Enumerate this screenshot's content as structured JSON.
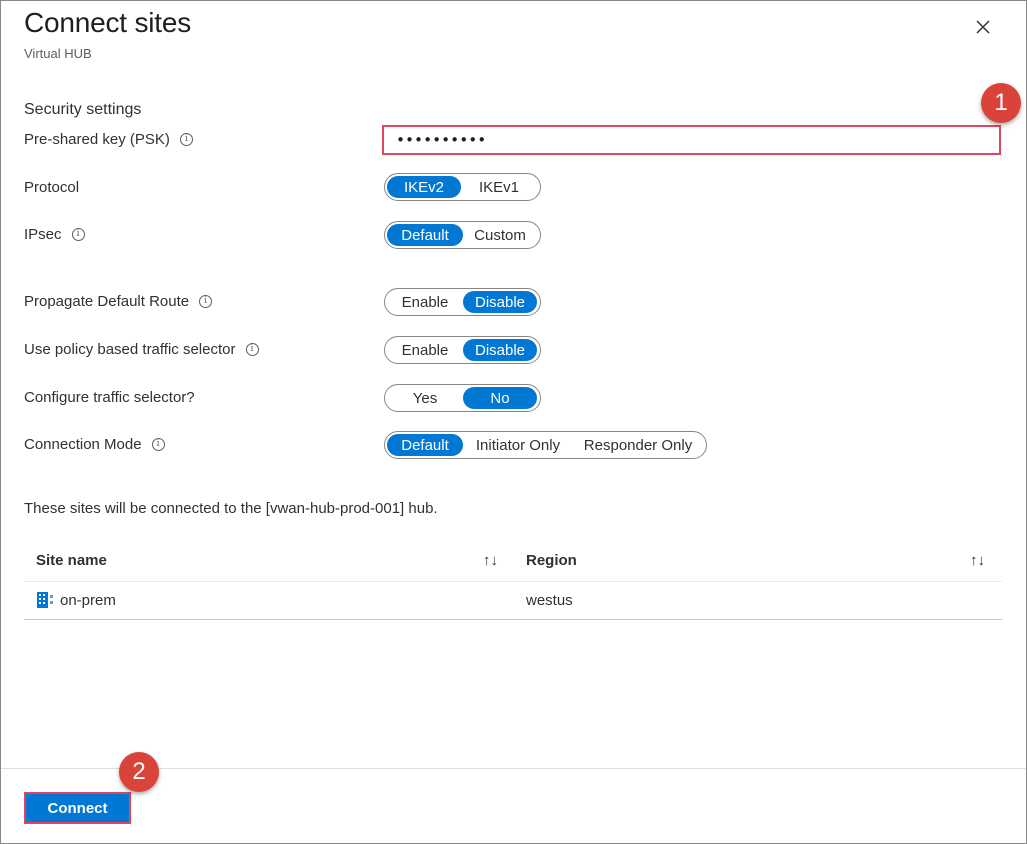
{
  "header": {
    "title": "Connect sites",
    "subtitle": "Virtual HUB",
    "close_icon": "close-icon"
  },
  "security": {
    "section_title": "Security settings",
    "psk_label": "Pre-shared key (PSK)",
    "psk_value": "••••••••••"
  },
  "protocol": {
    "label": "Protocol",
    "options": [
      "IKEv2",
      "IKEv1"
    ],
    "selected": "IKEv2"
  },
  "ipsec": {
    "label": "IPsec",
    "options": [
      "Default",
      "Custom"
    ],
    "selected": "Default"
  },
  "propagate": {
    "label": "Propagate Default Route",
    "options": [
      "Enable",
      "Disable"
    ],
    "selected": "Disable"
  },
  "policy_selector": {
    "label": "Use policy based traffic selector",
    "options": [
      "Enable",
      "Disable"
    ],
    "selected": "Disable"
  },
  "configure_selector": {
    "label": "Configure traffic selector?",
    "options": [
      "Yes",
      "No"
    ],
    "selected": "No"
  },
  "connection_mode": {
    "label": "Connection Mode",
    "options": [
      "Default",
      "Initiator Only",
      "Responder Only"
    ],
    "selected": "Default"
  },
  "sites": {
    "description": "These sites will be connected to the [vwan-hub-prod-001] hub.",
    "columns": [
      "Site name",
      "Region"
    ],
    "rows": [
      {
        "site": "on-prem",
        "region": "westus"
      }
    ]
  },
  "footer": {
    "connect_label": "Connect"
  },
  "callouts": [
    "1",
    "2"
  ],
  "colors": {
    "accent": "#0078d4",
    "highlight": "#e0475a",
    "callout": "#d9433a"
  }
}
